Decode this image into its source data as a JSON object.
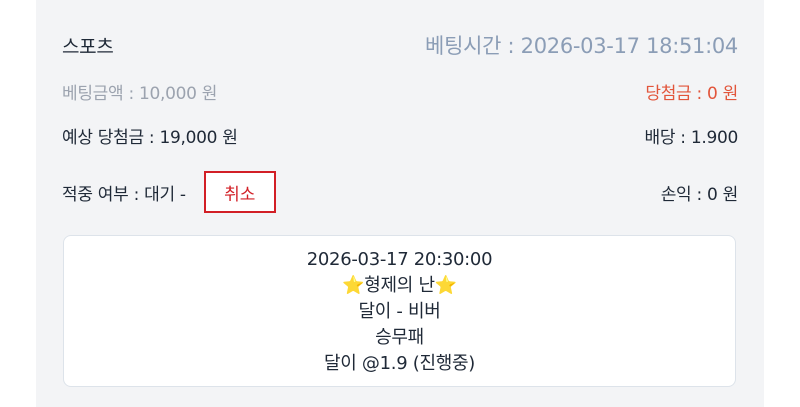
{
  "bet": {
    "category": "스포츠",
    "bet_time": "베팅시간 : 2026-03-17 18:51:04",
    "bet_amount": "베팅금액 : 10,000 원",
    "win_amount": "당첨금 : 0 원",
    "expected_win": "예상 당첨금 : 19,000 원",
    "odds": "배당 : 1.900",
    "result_status": "적중 여부 : 대기 -",
    "cancel_label": "취소",
    "profit": "손익 : 0 원"
  },
  "game": {
    "datetime": "2026-03-17 20:30:00",
    "star_left": "⭐",
    "league": "형제의 난",
    "star_right": "⭐",
    "match": "달이 - 비버",
    "market": "승무패",
    "pick": "달이 @1.9 (진행중)"
  },
  "colors": {
    "win_red": "#e2553b",
    "cancel_red": "#d21f26",
    "bet_time_blue": "#8b9db6"
  }
}
